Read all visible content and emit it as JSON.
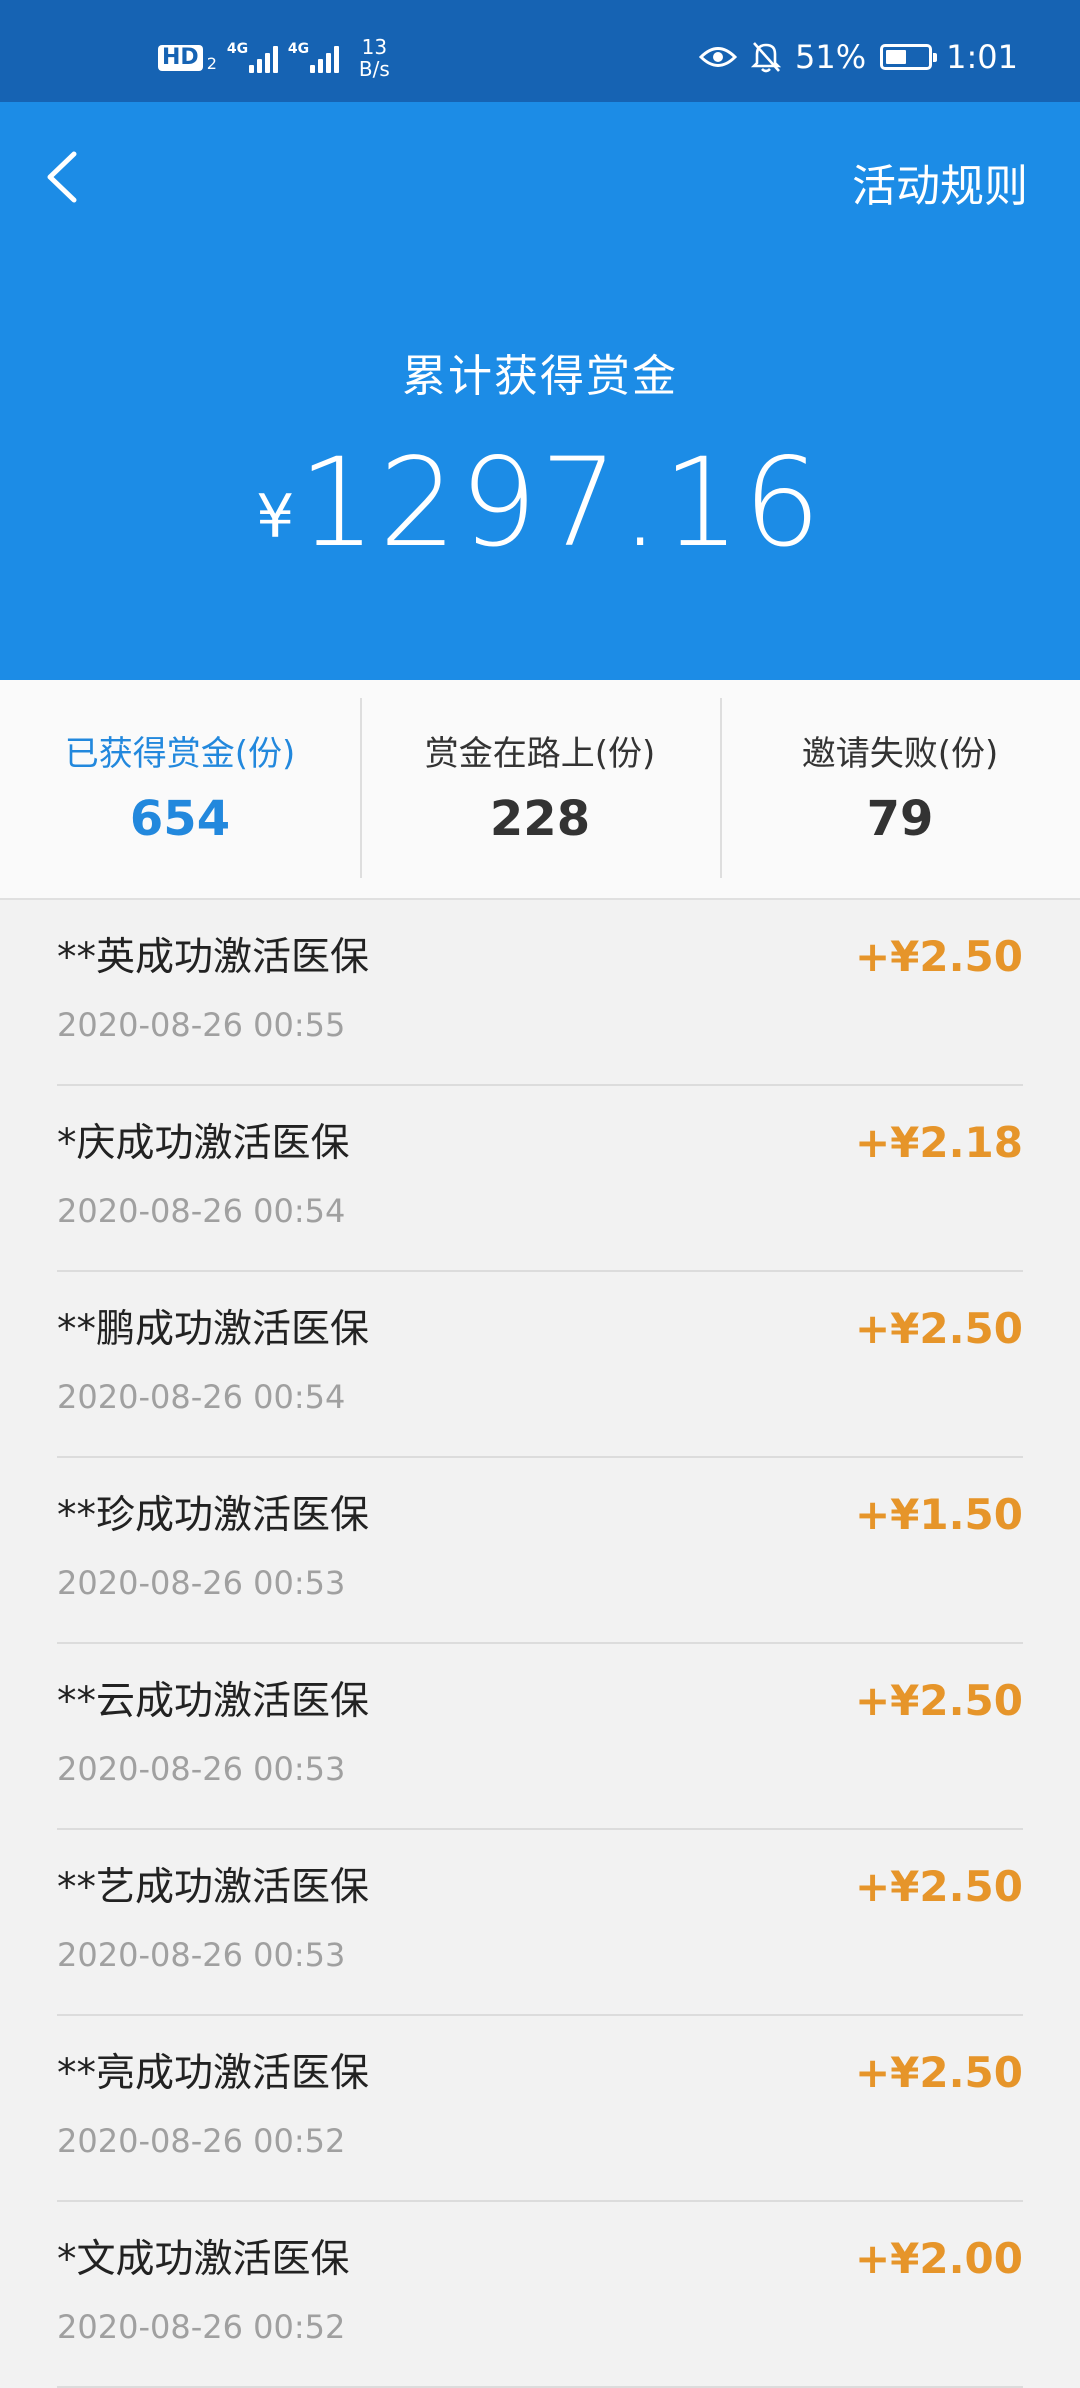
{
  "status_bar": {
    "hd": "HD",
    "hd_sub": "2",
    "signal_1_tag": "4G",
    "signal_2_tag": "4G",
    "net_speed_value": "13",
    "net_speed_unit": "B/s",
    "battery_percent": "51%",
    "battery_level": 0.51,
    "time": "1:01"
  },
  "header": {
    "rules_label": "活动规则",
    "summary_title": "累计获得赏金",
    "currency_symbol": "¥",
    "total_amount": "1297.16"
  },
  "stats": [
    {
      "label": "已获得赏金(份)",
      "value": "654",
      "active": true
    },
    {
      "label": "赏金在路上(份)",
      "value": "228",
      "active": false
    },
    {
      "label": "邀请失败(份)",
      "value": "79",
      "active": false
    }
  ],
  "records": [
    {
      "title": "**英成功激活医保",
      "time": "2020-08-26 00:55",
      "amount": "+¥2.50"
    },
    {
      "title": "*庆成功激活医保",
      "time": "2020-08-26 00:54",
      "amount": "+¥2.18"
    },
    {
      "title": "**鹏成功激活医保",
      "time": "2020-08-26 00:54",
      "amount": "+¥2.50"
    },
    {
      "title": "**珍成功激活医保",
      "time": "2020-08-26 00:53",
      "amount": "+¥1.50"
    },
    {
      "title": "**云成功激活医保",
      "time": "2020-08-26 00:53",
      "amount": "+¥2.50"
    },
    {
      "title": "**艺成功激活医保",
      "time": "2020-08-26 00:53",
      "amount": "+¥2.50"
    },
    {
      "title": "**亮成功激活医保",
      "time": "2020-08-26 00:52",
      "amount": "+¥2.50"
    },
    {
      "title": "*文成功激活医保",
      "time": "2020-08-26 00:52",
      "amount": "+¥2.00"
    }
  ],
  "colors": {
    "status_bar": "#1663b3",
    "header": "#1c8ce6",
    "active_stat": "#2288dd",
    "amount": "#e6952a"
  }
}
